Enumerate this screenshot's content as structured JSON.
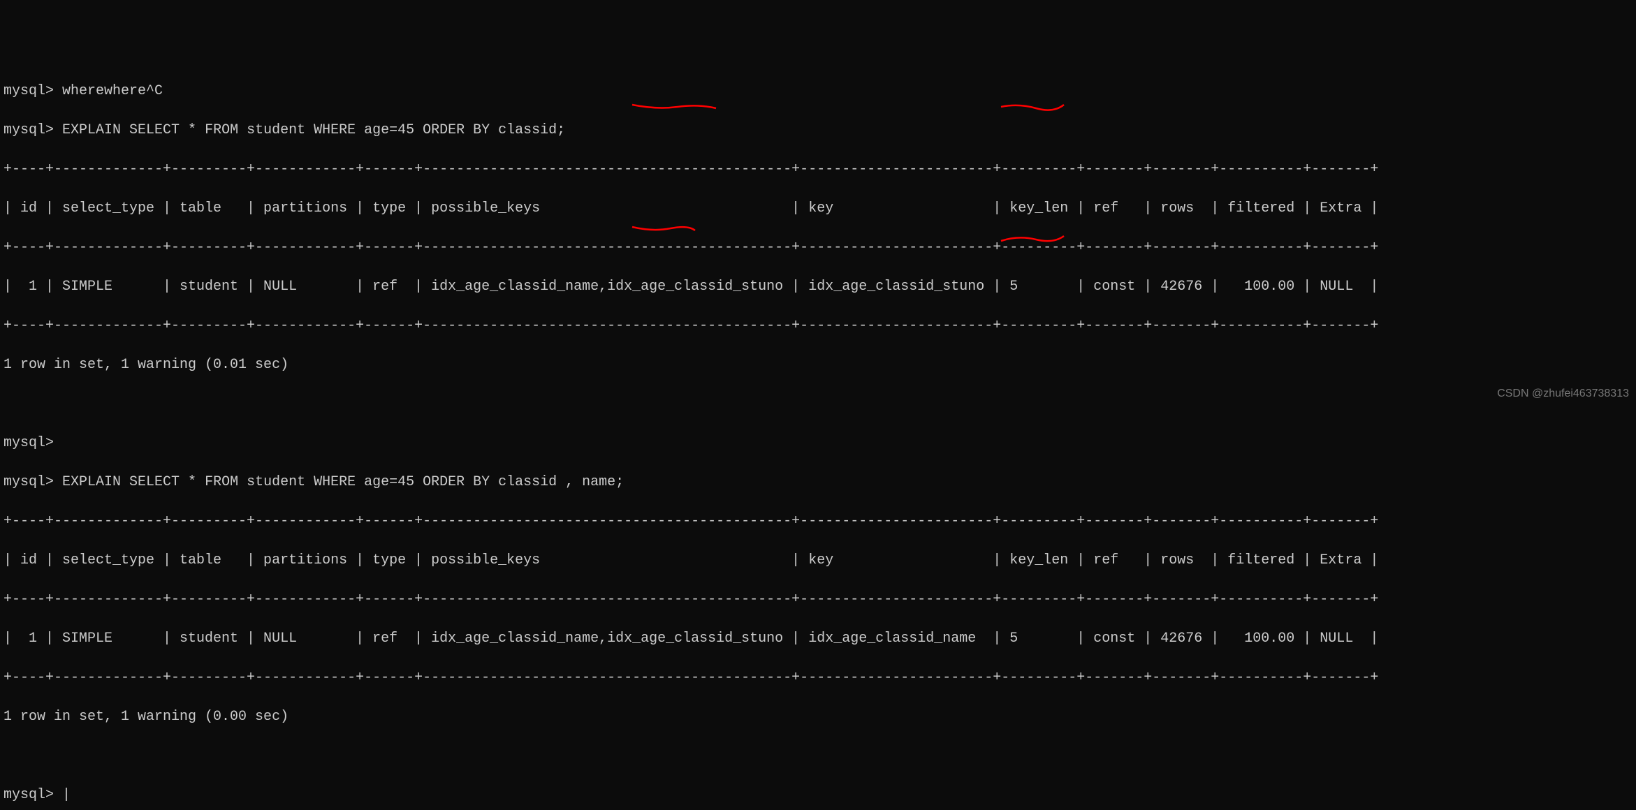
{
  "prompt": "mysql>",
  "line_cancelled": "wherewhere^C",
  "query1": "EXPLAIN SELECT * FROM student WHERE age=45 ORDER BY classid;",
  "query2": "EXPLAIN SELECT * FROM student WHERE age=45 ORDER BY classid , name;",
  "separator": "+----+-------------+---------+------------+------+--------------------------------------------+-----------------------+---------+-------+-------+----------+-------+",
  "header_row": "| id | select_type | table   | partitions | type | possible_keys                              | key                   | key_len | ref   | rows  | filtered | Extra |",
  "data_row1": "|  1 | SIMPLE      | student | NULL       | ref  | idx_age_classid_name,idx_age_classid_stuno | idx_age_classid_stuno | 5       | const | 42676 |   100.00 | NULL  |",
  "data_row2": "|  1 | SIMPLE      | student | NULL       | ref  | idx_age_classid_name,idx_age_classid_stuno | idx_age_classid_name  | 5       | const | 42676 |   100.00 | NULL  |",
  "result1": "1 row in set, 1 warning (0.01 sec)",
  "result2": "1 row in set, 1 warning (0.00 sec)",
  "watermark": "CSDN @zhufei463738313",
  "cursor": "|",
  "chart_data": {
    "type": "table",
    "tables": [
      {
        "query": "EXPLAIN SELECT * FROM student WHERE age=45 ORDER BY classid;",
        "columns": [
          "id",
          "select_type",
          "table",
          "partitions",
          "type",
          "possible_keys",
          "key",
          "key_len",
          "ref",
          "rows",
          "filtered",
          "Extra"
        ],
        "rows": [
          [
            "1",
            "SIMPLE",
            "student",
            "NULL",
            "ref",
            "idx_age_classid_name,idx_age_classid_stuno",
            "idx_age_classid_stuno",
            "5",
            "const",
            "42676",
            "100.00",
            "NULL"
          ]
        ]
      },
      {
        "query": "EXPLAIN SELECT * FROM student WHERE age=45 ORDER BY classid , name;",
        "columns": [
          "id",
          "select_type",
          "table",
          "partitions",
          "type",
          "possible_keys",
          "key",
          "key_len",
          "ref",
          "rows",
          "filtered",
          "Extra"
        ],
        "rows": [
          [
            "1",
            "SIMPLE",
            "student",
            "NULL",
            "ref",
            "idx_age_classid_name,idx_age_classid_stuno",
            "idx_age_classid_name",
            "5",
            "const",
            "42676",
            "100.00",
            "NULL"
          ]
        ]
      }
    ]
  }
}
